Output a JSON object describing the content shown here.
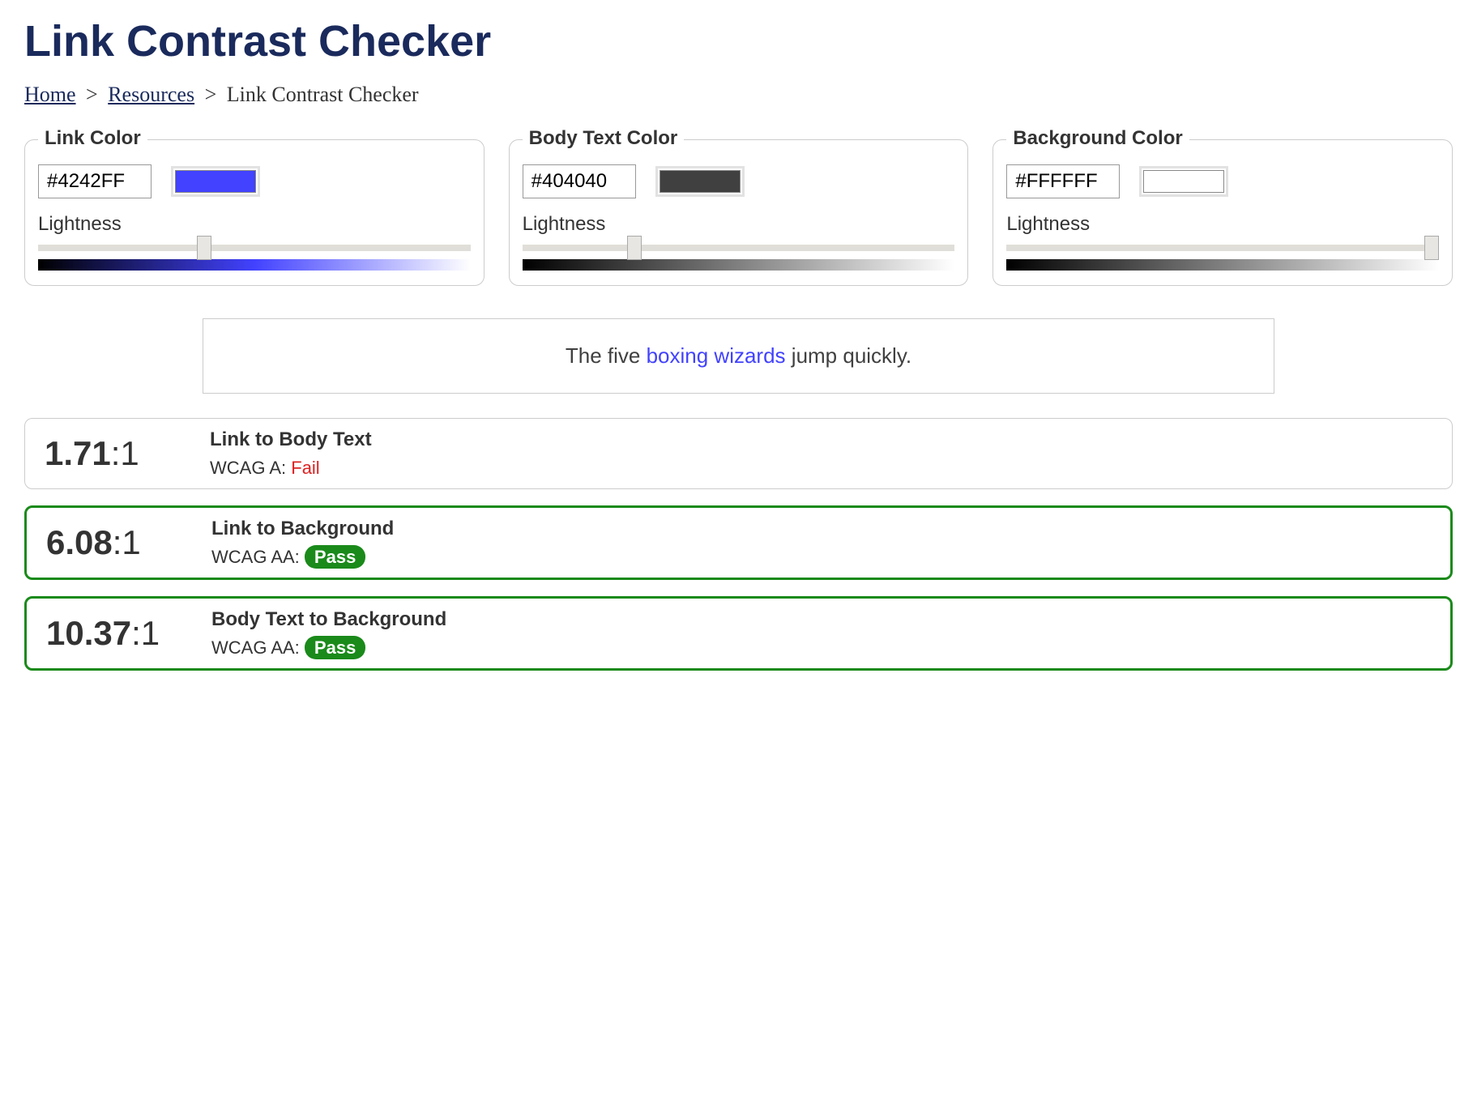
{
  "page": {
    "title": "Link Contrast Checker"
  },
  "breadcrumb": {
    "home": "Home",
    "resources": "Resources",
    "current": "Link Contrast Checker",
    "separator": ">"
  },
  "panels": {
    "link": {
      "legend": "Link Color",
      "hex": "#4242FF",
      "swatch_color": "#4242FF",
      "lightness_label": "Lightness",
      "slider_value": 38,
      "gradient": "linear-gradient(to right, #000000, #4242FF 50%, #ffffff)"
    },
    "body": {
      "legend": "Body Text Color",
      "hex": "#404040",
      "swatch_color": "#404040",
      "lightness_label": "Lightness",
      "slider_value": 25,
      "gradient": "linear-gradient(to right, #000000, #808080 50%, #ffffff)"
    },
    "bg": {
      "legend": "Background Color",
      "hex": "#FFFFFF",
      "swatch_color": "#FFFFFF",
      "lightness_label": "Lightness",
      "slider_value": 100,
      "gradient": "linear-gradient(to right, #000000, #808080 50%, #ffffff)"
    }
  },
  "sample": {
    "before": "The five ",
    "link_text": "boxing wizards",
    "after": " jump quickly.",
    "text_color": "#404040",
    "link_color": "#4242FF",
    "bg_color": "#FFFFFF"
  },
  "results": [
    {
      "ratio": "1.71",
      "suffix": ":1",
      "title": "Link to Body Text",
      "level_label": "WCAG A: ",
      "status_text": "Fail",
      "pass": false
    },
    {
      "ratio": "6.08",
      "suffix": ":1",
      "title": "Link to Background",
      "level_label": "WCAG AA: ",
      "status_text": "Pass",
      "pass": true
    },
    {
      "ratio": "10.37",
      "suffix": ":1",
      "title": "Body Text to Background",
      "level_label": "WCAG AA: ",
      "status_text": "Pass",
      "pass": true
    }
  ]
}
